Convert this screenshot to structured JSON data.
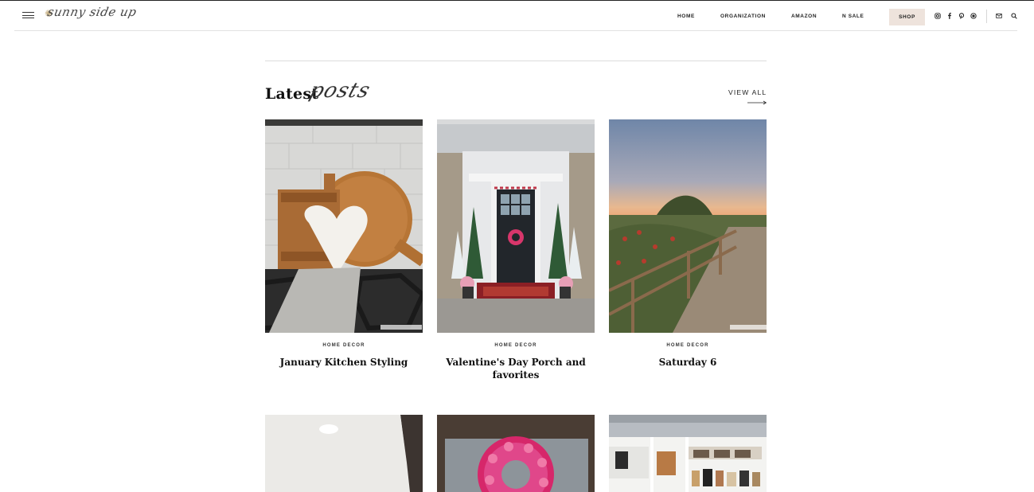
{
  "header": {
    "logo_text": "sunny side up",
    "nav": [
      {
        "label": "HOME"
      },
      {
        "label": "ORGANIZATION"
      },
      {
        "label": "AMAZON"
      },
      {
        "label": "N SALE"
      }
    ],
    "shop_label": "SHOP",
    "social_icons": [
      "instagram-icon",
      "facebook-icon",
      "pinterest-icon",
      "ltk-icon"
    ],
    "utility_icons": [
      "mail-icon",
      "search-icon"
    ]
  },
  "section": {
    "heading": "Latest",
    "heading_script": "posts",
    "view_all": "VIEW ALL"
  },
  "posts": [
    {
      "category": "HOME DECOR",
      "title": "January Kitchen Styling",
      "image": "kitchen cutting boards and heart board"
    },
    {
      "category": "HOME DECOR",
      "title": "Valentine's Day Porch and favorites",
      "image": "front porch with valentine wreath"
    },
    {
      "category": "HOME DECOR",
      "title": "Saturday 6",
      "image": "dirt trail with wooden fence at sunset"
    }
  ],
  "more_posts": [
    {
      "image": "white countertop"
    },
    {
      "image": "pink tulip wreath"
    },
    {
      "image": "closet shelves with handbags"
    }
  ],
  "colors": {
    "shop_bg": "#eee3dc",
    "text": "#111111",
    "rule": "#dcdcdc"
  }
}
